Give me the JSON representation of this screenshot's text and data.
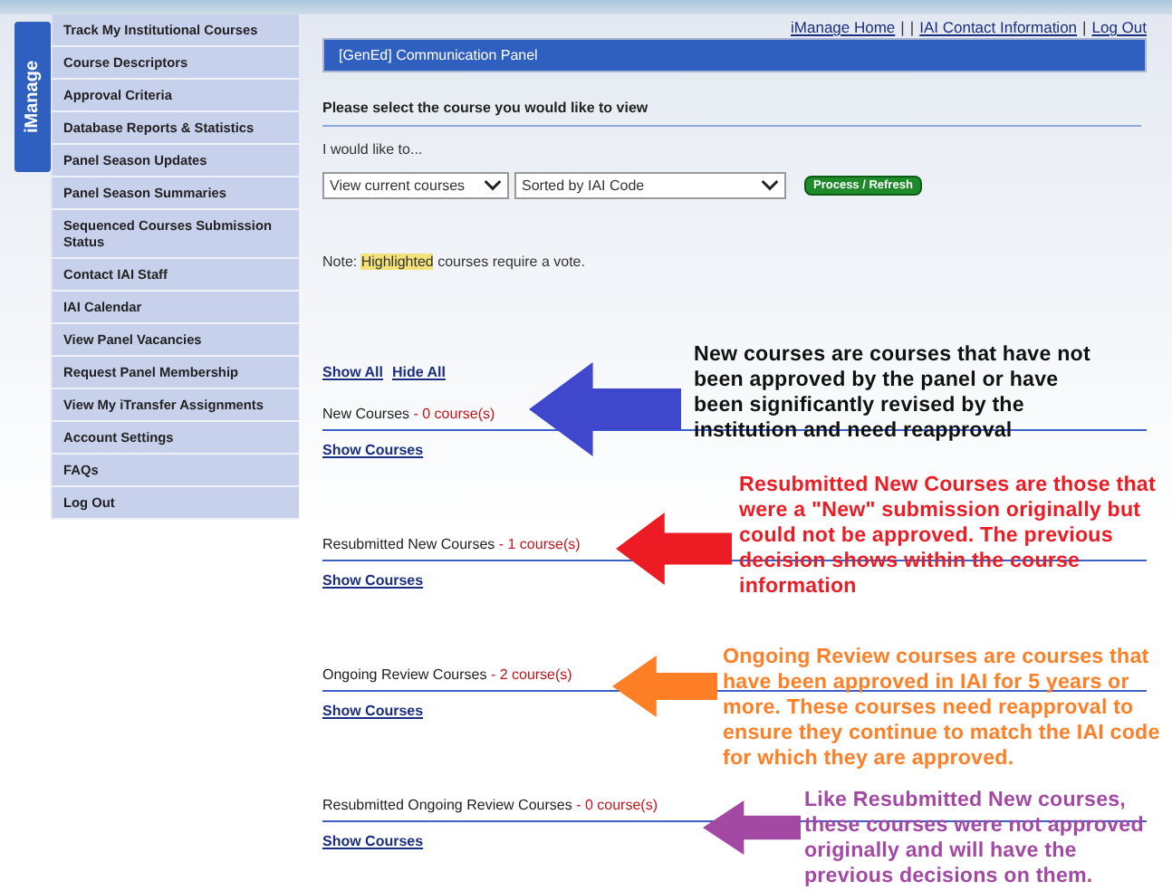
{
  "side_tab": {
    "label": "iManage"
  },
  "sidebar": {
    "items": [
      {
        "label": "Track My Institutional Courses"
      },
      {
        "label": "Course Descriptors"
      },
      {
        "label": "Approval Criteria"
      },
      {
        "label": "Database Reports & Statistics"
      },
      {
        "label": "Panel Season Updates"
      },
      {
        "label": "Panel Season Summaries"
      },
      {
        "label": "Sequenced Courses Submission Status"
      },
      {
        "label": "Contact IAI Staff"
      },
      {
        "label": "IAI Calendar"
      },
      {
        "label": "View Panel Vacancies"
      },
      {
        "label": "Request Panel Membership"
      },
      {
        "label": "View My iTransfer Assignments"
      },
      {
        "label": "Account Settings"
      },
      {
        "label": "FAQs"
      },
      {
        "label": "Log Out"
      }
    ]
  },
  "top_links": [
    "iManage Home",
    "|",
    "|",
    "IAI Contact Information",
    "|",
    "Log Out"
  ],
  "panel_title": "[GenEd] Communication Panel",
  "prompt": "Please select the course you would like to view",
  "would_like": "I would like to...",
  "view_select": {
    "value": "View current courses"
  },
  "sort_select": {
    "value": "Sorted by IAI Code"
  },
  "process_button": "Process / Refresh",
  "note": {
    "prefix": "Note:",
    "highlight": "Highlighted",
    "suffix": "courses require a vote."
  },
  "toggle_links": [
    "Show All",
    "Hide All"
  ],
  "sections": [
    {
      "title": "New Courses",
      "count": "- 0 course(s)",
      "link": "Show Courses"
    },
    {
      "title": "Resubmitted New Courses",
      "count": "- 1 course(s)",
      "link": "Show Courses"
    },
    {
      "title": "Ongoing Review Courses",
      "count": "- 2 course(s)",
      "link": "Show Courses"
    },
    {
      "title": "Resubmitted Ongoing Review Courses",
      "count": "- 0 course(s)",
      "link": "Show Courses"
    }
  ],
  "annotations": [
    {
      "arrow": {
        "color": "#3f48cc"
      },
      "note": {
        "color": "#111111",
        "text": "New courses are courses that have not been approved by the panel or have been significantly revised by the institution and need reapproval"
      }
    },
    {
      "arrow": {
        "color": "#ed1c24"
      },
      "note": {
        "color": "#ed1c24",
        "text": "Resubmitted New Courses are those that were a \"New\" submission originally but could not be approved.  The previous decision shows within the course information"
      }
    },
    {
      "arrow": {
        "color": "#ff7f27"
      },
      "note": {
        "color": "#ff7f27",
        "text": "Ongoing Review courses are courses that have been approved in IAI for 5 years or more.  These courses need reapproval to ensure they continue to match the IAI code for which they are approved."
      }
    },
    {
      "arrow": {
        "color": "#a349a4"
      },
      "note": {
        "color": "#a349a4",
        "text": "Like Resubmitted New courses, these courses were not approved originally and will have the previous decisions on them."
      }
    }
  ]
}
